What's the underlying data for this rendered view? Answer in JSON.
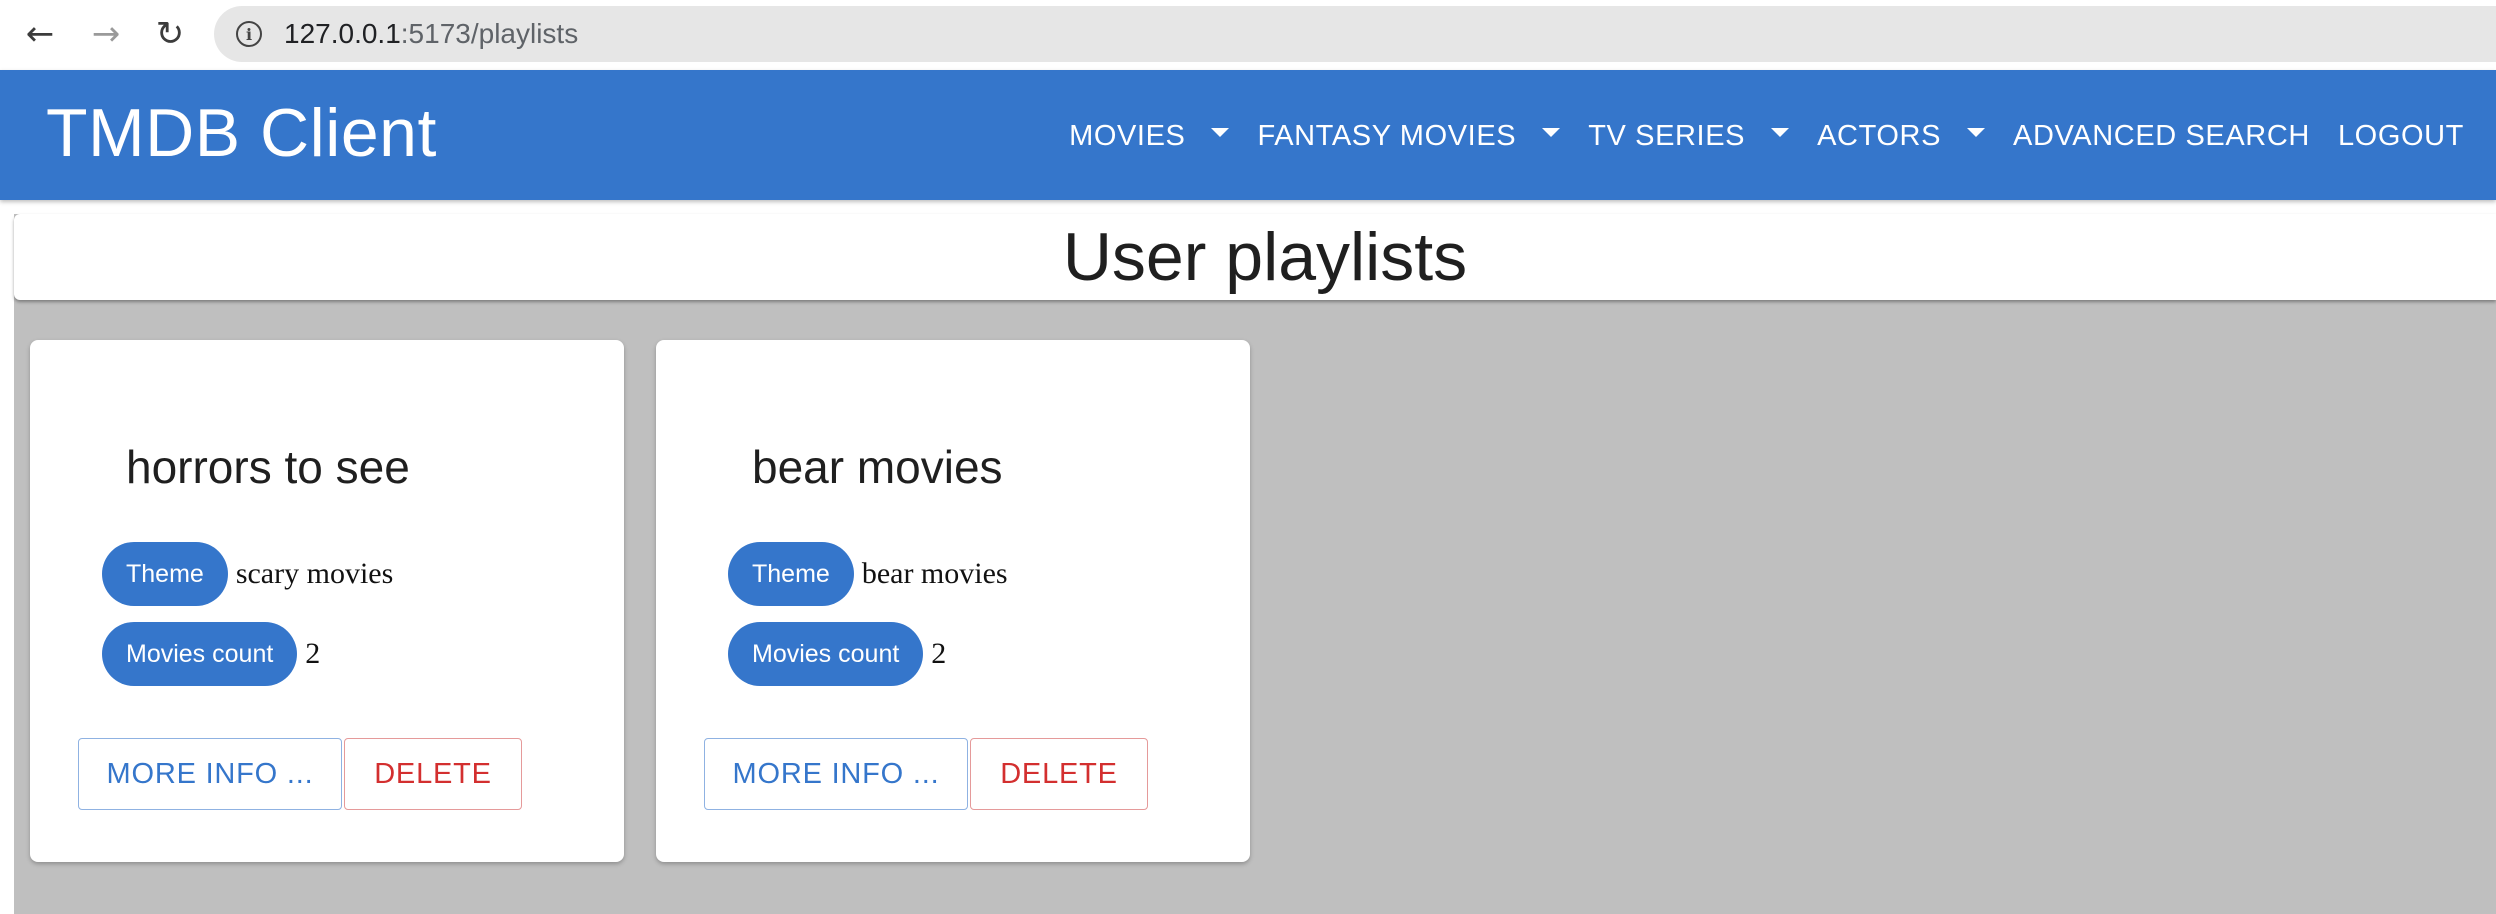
{
  "browser": {
    "back_icon": "←",
    "forward_icon": "→",
    "reload_icon": "↻",
    "url_host": "127.0.0.1",
    "url_path": ":5173/playlists"
  },
  "app": {
    "title": "TMDB Client",
    "nav": [
      {
        "label": "MOVIES",
        "dropdown": true
      },
      {
        "label": "FANTASY MOVIES",
        "dropdown": true
      },
      {
        "label": "TV SERIES",
        "dropdown": true
      },
      {
        "label": "ACTORS",
        "dropdown": true
      },
      {
        "label": "ADVANCED SEARCH",
        "dropdown": false
      },
      {
        "label": "LOGOUT",
        "dropdown": false
      }
    ],
    "accent_color": "#3576cb"
  },
  "page": {
    "title": "User playlists"
  },
  "playlists": [
    {
      "title": "horrors to see",
      "theme_label": "Theme",
      "theme_value": "scary movies",
      "count_label": "Movies count",
      "count_value": "2",
      "more_info_label": "MORE INFO ...",
      "delete_label": "DELETE"
    },
    {
      "title": "bear movies",
      "theme_label": "Theme",
      "theme_value": "bear movies",
      "count_label": "Movies count",
      "count_value": "2",
      "more_info_label": "MORE INFO ...",
      "delete_label": "DELETE"
    }
  ]
}
